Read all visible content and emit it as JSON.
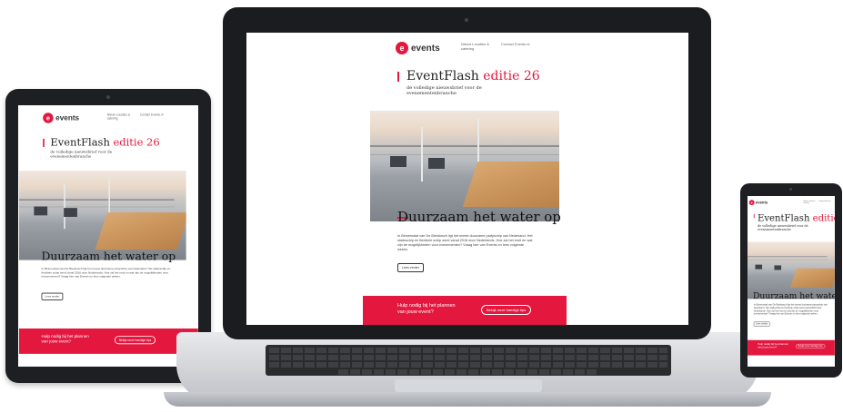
{
  "newsletter": {
    "logo_text": "events",
    "logo_mark": "e",
    "nav1": "Nieuw Locaties & catering",
    "nav2": "Contact Events.nl",
    "title_main": "EventFlash",
    "title_accent": "editie 26",
    "subtitle": "de volledige nieuwsbrief voor de evenementenbranche",
    "headline": "Duurzaam het water op",
    "body": "In Binnenstad van De Biesbosch ligt het meest duurzame partyschip van Nederland. Het stadsschip en flexibele schip werd vanaf 2016 door Nederlands. Hoe zal het eruit en wat zijn de mogelijkheden voor evenementen? Vraag hier van Events en lees volgende weken.",
    "read_more": "Lees verder",
    "footer_text": "Hulp nodig bij het plannen van jouw event?",
    "footer_button": "Bekijk onze handige tips"
  },
  "colors": {
    "accent": "#e4173f",
    "device": "#1d1f22",
    "laptop_body": "#c9ccd1"
  }
}
